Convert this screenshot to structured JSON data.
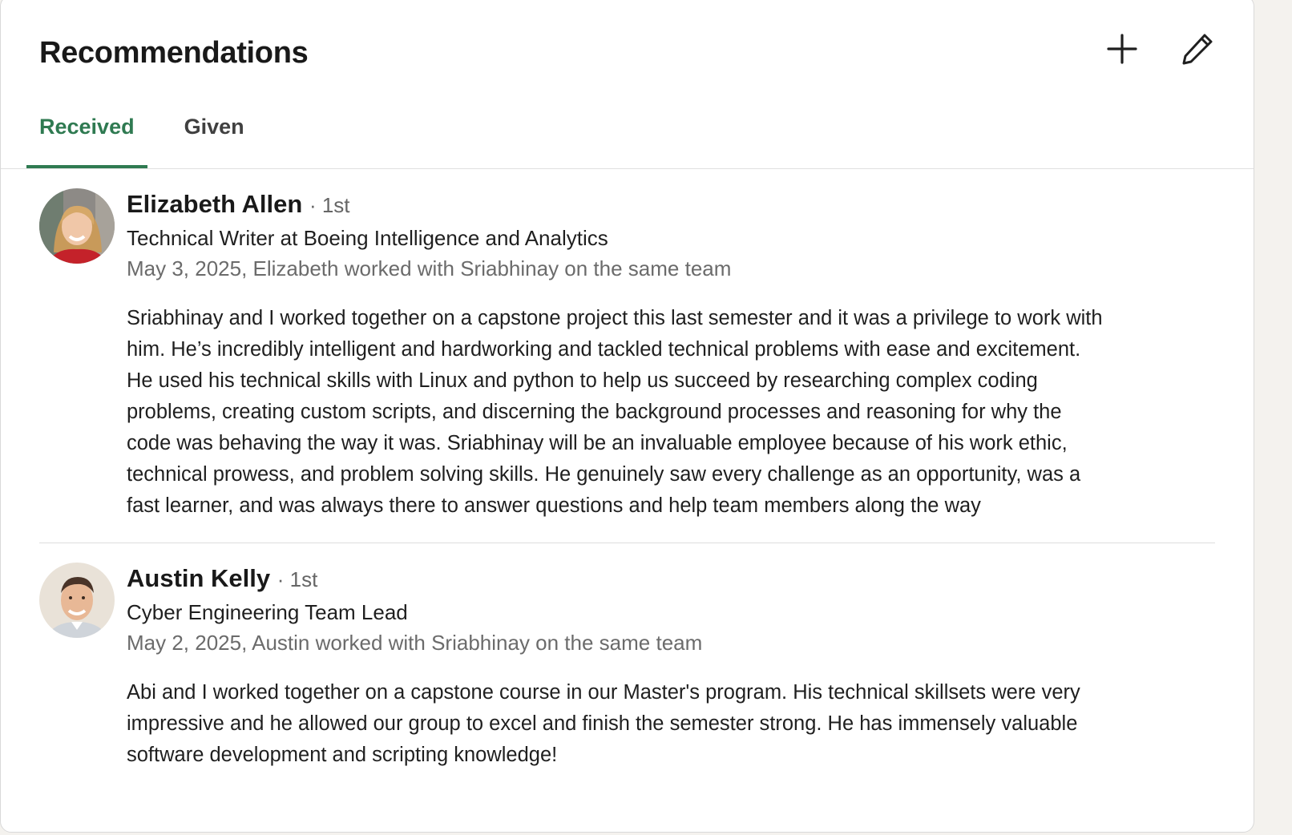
{
  "section": {
    "title": "Recommendations",
    "add_icon": "plus-icon",
    "edit_icon": "pencil-icon"
  },
  "tabs": [
    {
      "label": "Received",
      "active": true
    },
    {
      "label": "Given",
      "active": false
    }
  ],
  "colors": {
    "accent": "#2f7a51",
    "text": "#1f1f1f",
    "muted": "#6b6b6b"
  },
  "recommendations": [
    {
      "name": "Elizabeth Allen",
      "degree": "· 1st",
      "headline": "Technical Writer at Boeing Intelligence and Analytics",
      "meta": "May 3, 2025, Elizabeth worked with Sriabhinay on the same team",
      "text": "Sriabhinay and I worked together on a capstone project this last semester and it was a privilege to work with\nhim. He’s incredibly intelligent and hardworking and tackled technical problems with ease and excitement.\nHe used his technical skills with Linux and python to help us succeed by researching complex coding\nproblems, creating custom scripts, and discerning the background processes and reasoning for why the\ncode was behaving the way it was. Sriabhinay will be an invaluable employee because of his work ethic,\ntechnical prowess, and problem solving skills. He genuinely saw every challenge as an opportunity, was a\nfast learner, and was always there to answer questions and help team members along the way"
    },
    {
      "name": "Austin Kelly",
      "degree": "· 1st",
      "headline": "Cyber Engineering Team Lead",
      "meta": "May 2, 2025, Austin worked with Sriabhinay on the same team",
      "text": "Abi and I worked together on a capstone course in our Master's program. His technical skillsets were very\nimpressive and he allowed our group to excel and finish the semester strong. He has immensely valuable\nsoftware development and scripting knowledge!"
    }
  ]
}
